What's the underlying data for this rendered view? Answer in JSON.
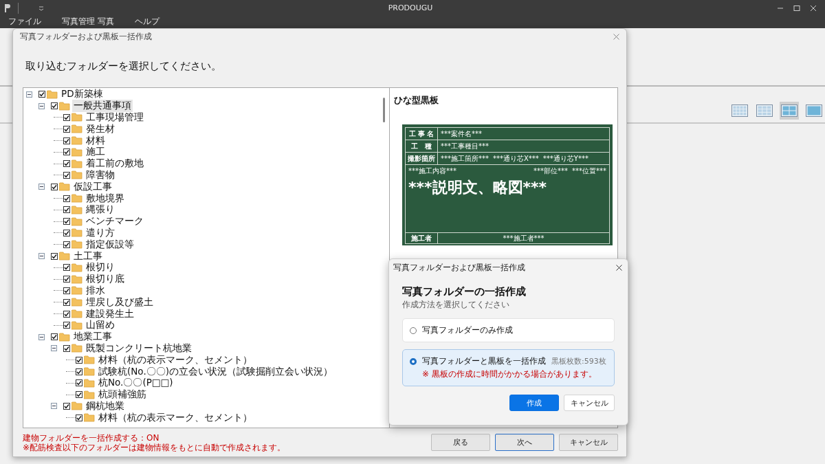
{
  "app": {
    "title": "PRODOUGU",
    "menu": [
      "ファイル",
      "写真管理 写真",
      "ヘルプ"
    ],
    "view_modes": [
      {
        "selected": false
      },
      {
        "selected": false
      },
      {
        "selected": true
      },
      {
        "selected": false
      }
    ]
  },
  "dialog": {
    "title": "写真フォルダーおよび黒板一括作成",
    "heading": "取り込むフォルダーを選択してください。",
    "tree": {
      "nodes": [
        {
          "label": "PD新築棟",
          "checked": true,
          "expanded": true,
          "selected": false,
          "children": [
            {
              "label": "一般共通事項",
              "checked": true,
              "expanded": true,
              "selected": true,
              "children": [
                {
                  "label": "工事現場管理",
                  "checked": true,
                  "selected": false
                },
                {
                  "label": "発生材",
                  "checked": true,
                  "selected": false
                },
                {
                  "label": "材料",
                  "checked": true,
                  "selected": false
                },
                {
                  "label": "施工",
                  "checked": true,
                  "selected": false
                },
                {
                  "label": "着工前の敷地",
                  "checked": true,
                  "selected": false
                },
                {
                  "label": "障害物",
                  "checked": true,
                  "selected": false
                }
              ]
            },
            {
              "label": "仮設工事",
              "checked": true,
              "expanded": true,
              "selected": false,
              "children": [
                {
                  "label": "敷地境界",
                  "checked": true,
                  "selected": false
                },
                {
                  "label": "縄張り",
                  "checked": true,
                  "selected": false
                },
                {
                  "label": "ベンチマーク",
                  "checked": true,
                  "selected": false
                },
                {
                  "label": "遣り方",
                  "checked": true,
                  "selected": false
                },
                {
                  "label": "指定仮設等",
                  "checked": true,
                  "selected": false
                }
              ]
            },
            {
              "label": "土工事",
              "checked": true,
              "expanded": true,
              "selected": false,
              "children": [
                {
                  "label": "根切り",
                  "checked": true,
                  "selected": false
                },
                {
                  "label": "根切り底",
                  "checked": true,
                  "selected": false
                },
                {
                  "label": "排水",
                  "checked": true,
                  "selected": false
                },
                {
                  "label": "埋戻し及び盛土",
                  "checked": true,
                  "selected": false
                },
                {
                  "label": "建設発生土",
                  "checked": true,
                  "selected": false
                },
                {
                  "label": "山留め",
                  "checked": true,
                  "selected": false
                }
              ]
            },
            {
              "label": "地業工事",
              "checked": true,
              "expanded": true,
              "selected": false,
              "children": [
                {
                  "label": "既製コンクリート杭地業",
                  "checked": true,
                  "expanded": true,
                  "selected": false,
                  "children": [
                    {
                      "label": "材料（杭の表示マーク、セメント）",
                      "checked": true,
                      "selected": false
                    },
                    {
                      "label": "試験杭(No.〇〇)の立会い状況（試験掘削立会い状況）",
                      "checked": true,
                      "selected": false
                    },
                    {
                      "label": "杭No.〇〇(P□□)",
                      "checked": true,
                      "selected": false
                    },
                    {
                      "label": "杭頭補強筋",
                      "checked": true,
                      "selected": false
                    }
                  ]
                },
                {
                  "label": "鋼杭地業",
                  "checked": true,
                  "expanded": true,
                  "selected": false,
                  "children": [
                    {
                      "label": "材料（杭の表示マーク、セメント）",
                      "checked": true,
                      "selected": false
                    }
                  ]
                }
              ]
            }
          ]
        }
      ]
    },
    "preview": {
      "title": "ひな型黒板",
      "board": {
        "rows": [
          {
            "label": "工 事 名",
            "values": [
              "***案件名***"
            ]
          },
          {
            "label": "工　種",
            "values": [
              "***工事種目***"
            ]
          },
          {
            "label": "撮影箇所",
            "values": [
              "***施工箇所***",
              "***通り芯X***",
              "***通り芯Y***"
            ]
          }
        ],
        "body_left": "***施工内容***",
        "body_right": [
          "***部位***",
          "***位置***"
        ],
        "body_main": "***説明文、略図***",
        "footer_label": "施工者",
        "footer_value": "***施工者***"
      }
    },
    "notes": [
      "建物フォルダーを一括作成する：ON",
      "※配筋検査以下のフォルダーは建物情報をもとに自動で作成されます。"
    ],
    "buttons": [
      {
        "label": "戻る",
        "focused": false
      },
      {
        "label": "次へ",
        "focused": true
      },
      {
        "label": "キャンセル",
        "focused": false
      }
    ]
  },
  "modal": {
    "title": "写真フォルダーおよび黒板一括作成",
    "heading": "写真フォルダーの一括作成",
    "subtitle": "作成方法を選択してください",
    "options": [
      {
        "label": "写真フォルダーのみ作成",
        "selected": false
      },
      {
        "label": "写真フォルダーと黒板を一括作成",
        "count": "黒板枚数:593枚",
        "note": "※ 黒板の作成に時間がかかる場合があります。",
        "selected": true
      }
    ],
    "buttons": [
      {
        "label": "作成",
        "primary": true
      },
      {
        "label": "キャンセル",
        "primary": false
      }
    ]
  }
}
